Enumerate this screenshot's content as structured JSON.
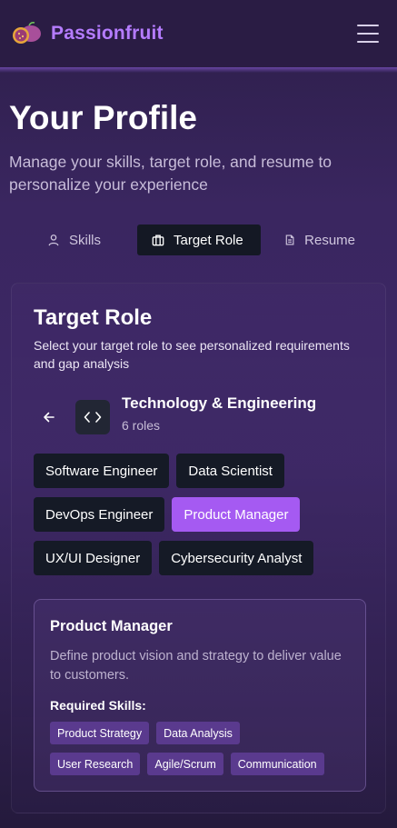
{
  "header": {
    "brand": "Passionfruit",
    "menu_icon": "hamburger-menu-icon"
  },
  "hero": {
    "title": "Your Profile",
    "subtitle": "Manage your skills, target role, and resume to personalize your experience"
  },
  "tabs": [
    {
      "label": "Skills",
      "icon": "user-icon",
      "active": false
    },
    {
      "label": "Target Role",
      "icon": "briefcase-icon",
      "active": true
    },
    {
      "label": "Resume",
      "icon": "document-icon",
      "active": false
    }
  ],
  "target_role": {
    "title": "Target Role",
    "description": "Select your target role to see personalized requirements and gap analysis",
    "category": {
      "name": "Technology & Engineering",
      "count": "6 roles",
      "icon": "code-icon"
    },
    "roles": [
      [
        "Software Engineer",
        "Data Scientist"
      ],
      [
        "DevOps Engineer",
        "Product Manager"
      ],
      [
        "UX/UI Designer",
        "Cybersecurity Analyst"
      ]
    ],
    "selected_role": "Product Manager",
    "detail": {
      "title": "Product Manager",
      "description": "Define product vision and strategy to deliver value to customers.",
      "required_label": "Required Skills:",
      "skills": [
        [
          "Product Strategy",
          "Data Analysis"
        ],
        [
          "User Research",
          "Agile/Scrum",
          "Communication"
        ]
      ]
    }
  },
  "colors": {
    "accent": "#a55af2",
    "brand": "#b57cff",
    "chip_dark": "#151a26",
    "skill_chip": "#5a3a8e"
  }
}
